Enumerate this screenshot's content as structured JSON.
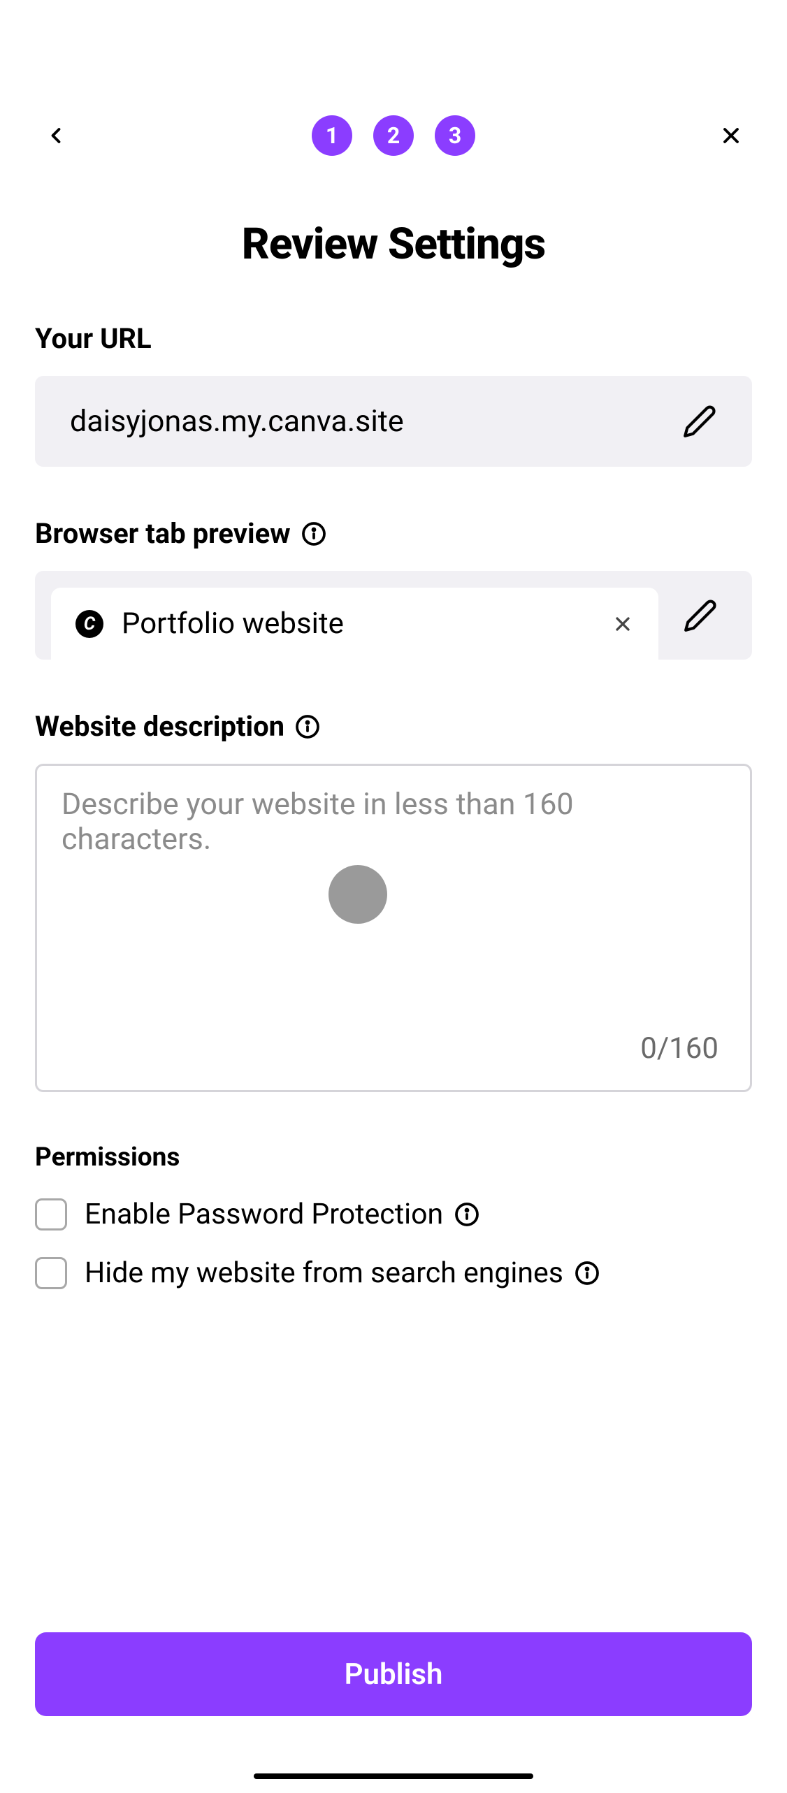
{
  "steps": [
    "1",
    "2",
    "3"
  ],
  "title": "Review Settings",
  "url": {
    "label": "Your URL",
    "value": "daisyjonas.my.canva.site"
  },
  "tabPreview": {
    "label": "Browser tab preview",
    "title": "Portfolio website",
    "favicon": "C"
  },
  "description": {
    "label": "Website description",
    "placeholder": "Describe your website in less than 160 characters.",
    "value": "",
    "charCount": "0/160"
  },
  "permissions": {
    "label": "Permissions",
    "passwordProtection": "Enable Password Protection",
    "hideFromSearch": "Hide my website from search engines"
  },
  "publishButton": "Publish"
}
